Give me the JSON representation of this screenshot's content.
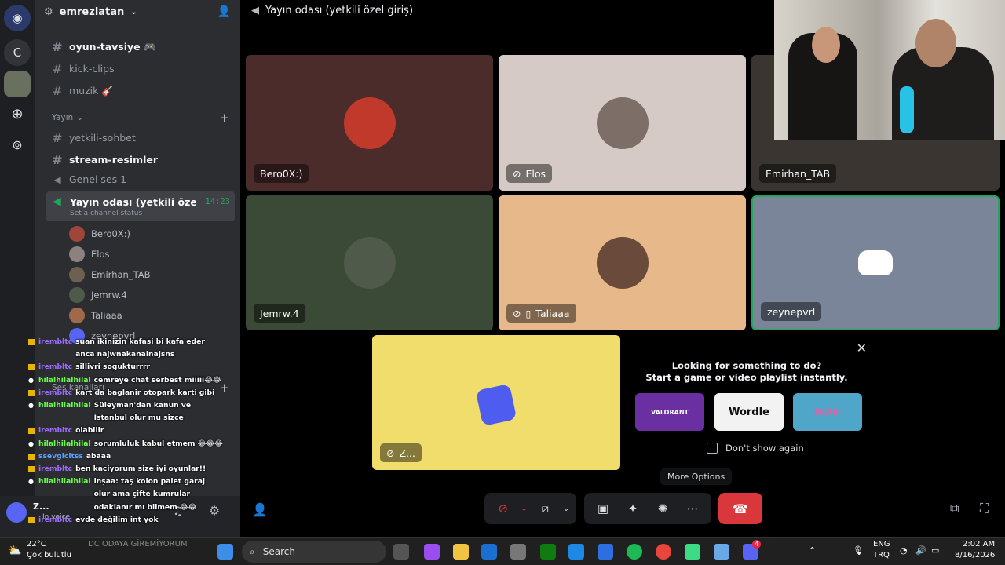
{
  "server": {
    "name": "emrezlatan"
  },
  "rail": {
    "letter": "C"
  },
  "channels": [
    {
      "name": "oyun-tavsiye 🎮",
      "bold": true
    },
    {
      "name": "kick-clips",
      "bold": false
    },
    {
      "name": "muzik 🎸",
      "bold": false
    }
  ],
  "category_yayin": "Yayın",
  "channels2": [
    {
      "name": "yetkili-sohbet",
      "bold": false
    },
    {
      "name": "stream-resimler",
      "bold": true
    }
  ],
  "voice_channel": "Genel ses 1",
  "active_channel": {
    "name": "Yayın odası (yetkili özel gi...",
    "time": "14:23",
    "status": "Set a channel status"
  },
  "voice_users": [
    "Bero0X:)",
    "Elos",
    "Emirhan_TAB",
    "Jemrw.4",
    "Taliaaa",
    "zeynepvrl"
  ],
  "category_ses": "Ses kanalları",
  "chat": [
    {
      "user": "irembltc",
      "msg": "suan ikinizin kafasi bi kafa eder anca najwnakanainajsns",
      "color": "#9c6bff",
      "src": "twitch"
    },
    {
      "user": "irembltc",
      "msg": "sillivri sogukturrrr",
      "color": "#9c6bff",
      "src": "twitch"
    },
    {
      "user": "hilalhilalhilal",
      "msg": "cemreye chat serbest miiiii😂😂",
      "color": "#6cff4a",
      "src": "kick"
    },
    {
      "user": "irembltc",
      "msg": "kart da baglanir otopark karti gibi",
      "color": "#9c6bff",
      "src": "twitch"
    },
    {
      "user": "hilalhilalhilal",
      "msg": "Süleyman'dan kanun ve İstanbul olur mu sizce",
      "color": "#6cff4a",
      "src": "kick"
    },
    {
      "user": "irembltc",
      "msg": "olabilir",
      "color": "#9c6bff",
      "src": "twitch"
    },
    {
      "user": "hilalhilalhilal",
      "msg": "sorumluluk kabul etmem 😂😂😂",
      "color": "#6cff4a",
      "src": "kick"
    },
    {
      "user": "ssevgicltss",
      "msg": "abaaa",
      "color": "#5aa0ff",
      "src": "twitch"
    },
    {
      "user": "irembltc",
      "msg": "ben kaciyorum size iyi oyunlar!!",
      "color": "#9c6bff",
      "src": "twitch"
    },
    {
      "user": "hilalhilalhilal",
      "msg": "inşaa: taş kolon palet garaj olur ama çifte kumrular odaklanır mı bilmem 😂😂",
      "color": "#6cff4a",
      "src": "kick"
    },
    {
      "user": "irembltc",
      "msg": "evde değilim int yok",
      "color": "#9c6bff",
      "src": "twitch"
    }
  ],
  "user_panel": {
    "name": "Z...",
    "status": "In voice"
  },
  "header": {
    "title": "Yayın odası (yetkili özel giriş)"
  },
  "tiles": [
    {
      "name": "Bero0X:)",
      "muted": false,
      "bg": "#4b2c2a",
      "av": "#c0392b"
    },
    {
      "name": "Elos",
      "muted": true,
      "bg": "#d5cac5",
      "av": "#7d6e68"
    },
    {
      "name": "Emirhan_TAB",
      "muted": false,
      "bg": "#3a3530",
      "av": "#555"
    },
    {
      "name": "Jemrw.4",
      "muted": false,
      "bg": "#3b4a36",
      "av": "#4f5a4a"
    },
    {
      "name": "Taliaaa",
      "muted": true,
      "bg": "#e6b88a",
      "av": "#6a4a3a"
    },
    {
      "name": "zeynepvrl",
      "muted": false,
      "bg": "#7b8599",
      "av": "#7b8599"
    }
  ],
  "activity_tile": {
    "name": "Z..."
  },
  "activity_panel": {
    "line1": "Looking for something to do?",
    "line2": "Start a game or video playlist instantly.",
    "games": [
      "VALORANT",
      "Wordle",
      "FARM"
    ],
    "dont_show": "Don't show again"
  },
  "tooltip": "More Options",
  "taskbar": {
    "weather_temp": "22°C",
    "weather_desc": "Çok bulutlu",
    "overlay_text": "DC ODAYA GİREMİYORUM",
    "search": "Search",
    "lang1": "ENG",
    "lang2": "TRQ",
    "time": "2:02 AM",
    "date": "8/16/2026",
    "badge": "4"
  }
}
